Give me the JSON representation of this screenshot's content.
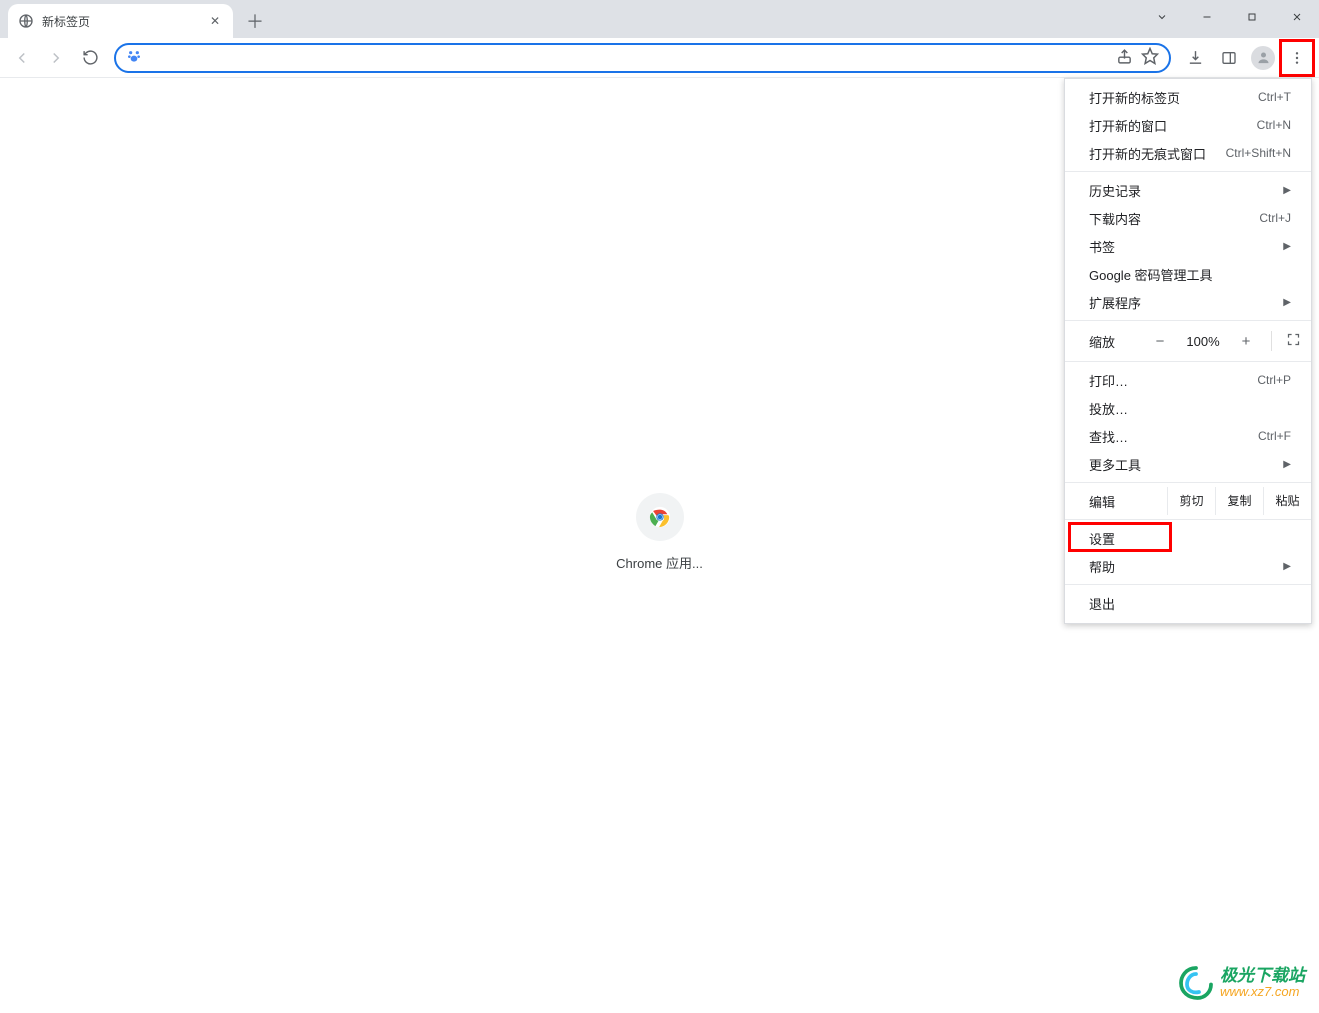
{
  "tab": {
    "title": "新标签页"
  },
  "omnibox": {
    "placeholder": ""
  },
  "shortcut": {
    "label": "Chrome 应用..."
  },
  "menu": {
    "new_tab": {
      "label": "打开新的标签页",
      "shortcut": "Ctrl+T"
    },
    "new_window": {
      "label": "打开新的窗口",
      "shortcut": "Ctrl+N"
    },
    "new_incognito": {
      "label": "打开新的无痕式窗口",
      "shortcut": "Ctrl+Shift+N"
    },
    "history": {
      "label": "历史记录"
    },
    "downloads": {
      "label": "下载内容",
      "shortcut": "Ctrl+J"
    },
    "bookmarks": {
      "label": "书签"
    },
    "password_manager": {
      "label": "Google 密码管理工具"
    },
    "extensions": {
      "label": "扩展程序"
    },
    "zoom": {
      "label": "缩放",
      "minus": "−",
      "pct": "100%",
      "plus": "+"
    },
    "print": {
      "label": "打印…",
      "shortcut": "Ctrl+P"
    },
    "cast": {
      "label": "投放…"
    },
    "find": {
      "label": "查找…",
      "shortcut": "Ctrl+F"
    },
    "more_tools": {
      "label": "更多工具"
    },
    "edit": {
      "label": "编辑",
      "cut": "剪切",
      "copy": "复制",
      "paste": "粘贴"
    },
    "settings": {
      "label": "设置"
    },
    "help": {
      "label": "帮助"
    },
    "exit": {
      "label": "退出"
    }
  },
  "watermark": {
    "cn": "极光下载站",
    "url": "www.xz7.com"
  }
}
